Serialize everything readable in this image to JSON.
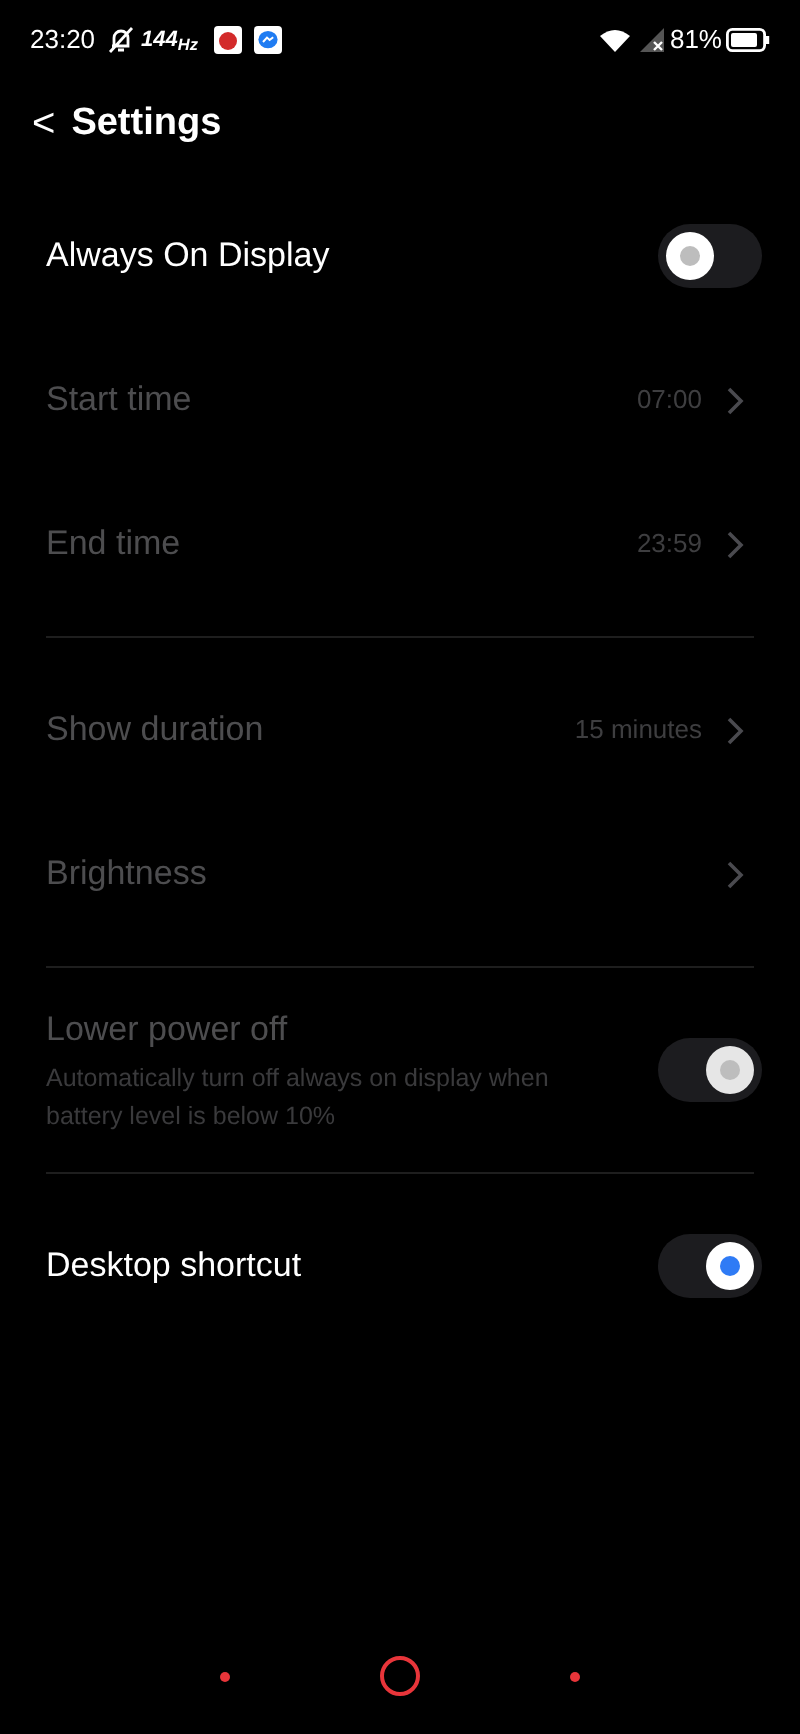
{
  "status_bar": {
    "time": "23:20",
    "refresh_rate": "144$_{Hz}$",
    "battery": "81%"
  },
  "header": {
    "back": "<",
    "title": "Settings"
  },
  "items": [
    {
      "kind": "toggle",
      "label": "Always On Display",
      "on": false,
      "disabled": false
    },
    {
      "kind": "link",
      "label": "Start time",
      "value": "07:00",
      "disabled": true
    },
    {
      "kind": "link",
      "label": "End time",
      "value": "23:59",
      "disabled": true
    },
    {
      "kind": "divider"
    },
    {
      "kind": "link",
      "label": "Show duration",
      "value": "15 minutes",
      "disabled": true
    },
    {
      "kind": "link",
      "label": "Brightness",
      "disabled": true
    },
    {
      "kind": "divider"
    },
    {
      "kind": "toggle",
      "label": "Lower power off",
      "description": "Automatically turn off always on display when battery level is below 10%",
      "on": true,
      "disabled": true
    },
    {
      "kind": "divider"
    },
    {
      "kind": "toggle",
      "label": "Desktop shortcut",
      "on": true,
      "disabled": false
    }
  ]
}
